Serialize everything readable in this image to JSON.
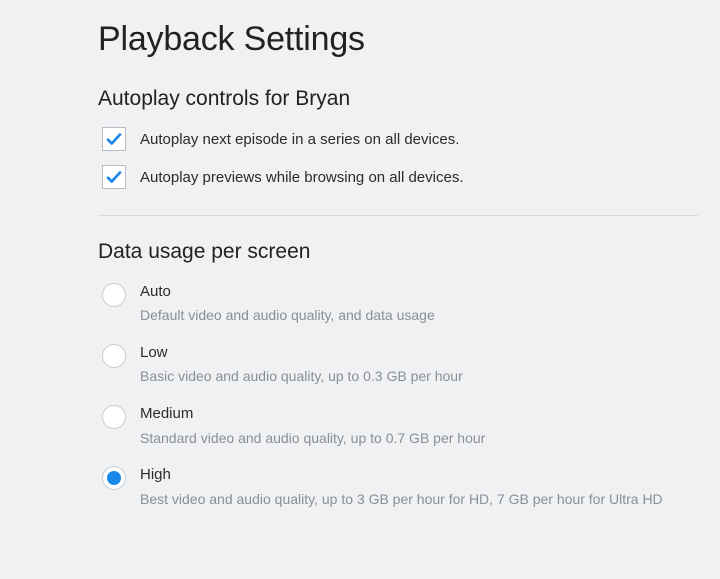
{
  "page": {
    "title": "Playback Settings"
  },
  "autoplay": {
    "heading": "Autoplay controls for Bryan",
    "options": [
      {
        "label": "Autoplay next episode in a series on all devices.",
        "checked": true
      },
      {
        "label": "Autoplay previews while browsing on all devices.",
        "checked": true
      }
    ]
  },
  "dataUsage": {
    "heading": "Data usage per screen",
    "options": [
      {
        "label": "Auto",
        "desc": "Default video and audio quality, and data usage",
        "selected": false
      },
      {
        "label": "Low",
        "desc": "Basic video and audio quality, up to 0.3 GB per hour",
        "selected": false
      },
      {
        "label": "Medium",
        "desc": "Standard video and audio quality, up to 0.7 GB per hour",
        "selected": false
      },
      {
        "label": "High",
        "desc": "Best video and audio quality, up to 3 GB per hour for HD, 7 GB per hour for Ultra HD",
        "selected": true
      }
    ]
  },
  "colors": {
    "accent": "#1988EA"
  }
}
